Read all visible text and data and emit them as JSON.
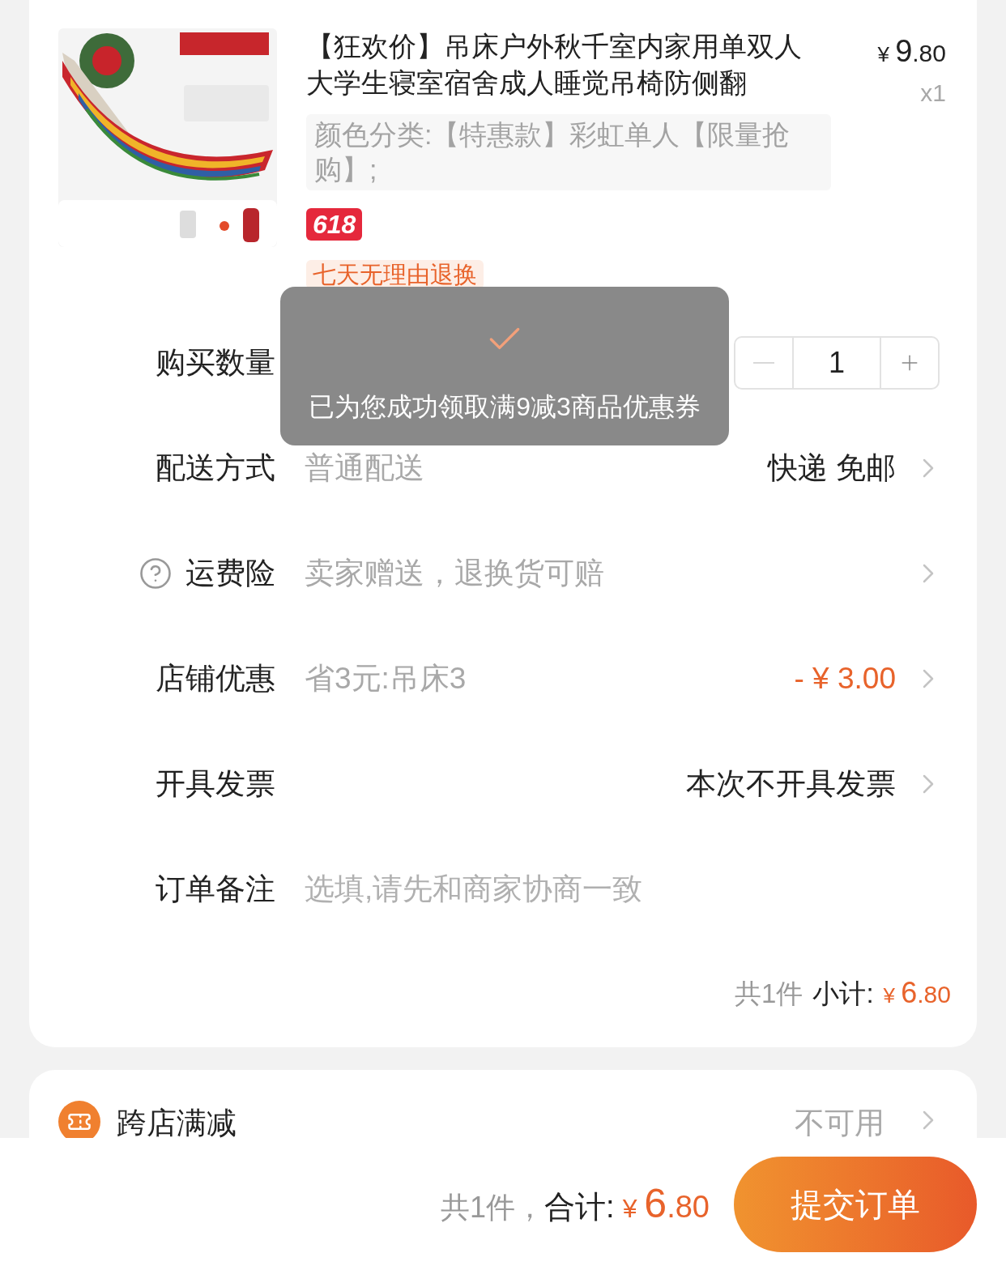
{
  "product": {
    "title": "【狂欢价】吊床户外秋千室内家用单双人大学生寝室宿舍成人睡觉吊椅防侧翻",
    "price": {
      "currency": "¥",
      "integer": "9",
      "decimal": ".80"
    },
    "quantity": "x1",
    "sku": "颜色分类:【特惠款】彩虹单人【限量抢购】;",
    "badge": "618",
    "service_tag": "七天无理由退换"
  },
  "rows": [
    {
      "kind": "stepper",
      "label": "购买数量",
      "value": "1",
      "minus_disabled": true
    },
    {
      "kind": "link",
      "label": "配送方式",
      "detail": "普通配送",
      "value": "快递 免邮",
      "highlight": false
    },
    {
      "kind": "link",
      "label": "运费险",
      "help": true,
      "detail": "卖家赠送，退换货可赔"
    },
    {
      "kind": "link",
      "label": "店铺优惠",
      "detail": "省3元:吊床3",
      "value": "- ¥ 3.00",
      "highlight": true
    },
    {
      "kind": "link",
      "label": "开具发票",
      "value": "本次不开具发票",
      "highlight": false
    },
    {
      "kind": "input",
      "label": "订单备注",
      "placeholder": "选填,请先和商家协商一致"
    }
  ],
  "subtotal": {
    "count": "共1件",
    "label": "小计:",
    "currency": "¥",
    "integer": "6",
    "decimal": ".80"
  },
  "cross_store": {
    "label": "跨店满减",
    "value": "不可用"
  },
  "toast": {
    "message": "已为您成功领取满9减3商品优惠券"
  },
  "footer": {
    "count": "共1件，",
    "label": "合计:",
    "currency": "¥",
    "integer": "6",
    "decimal": ".80",
    "submit": "提交订单"
  }
}
